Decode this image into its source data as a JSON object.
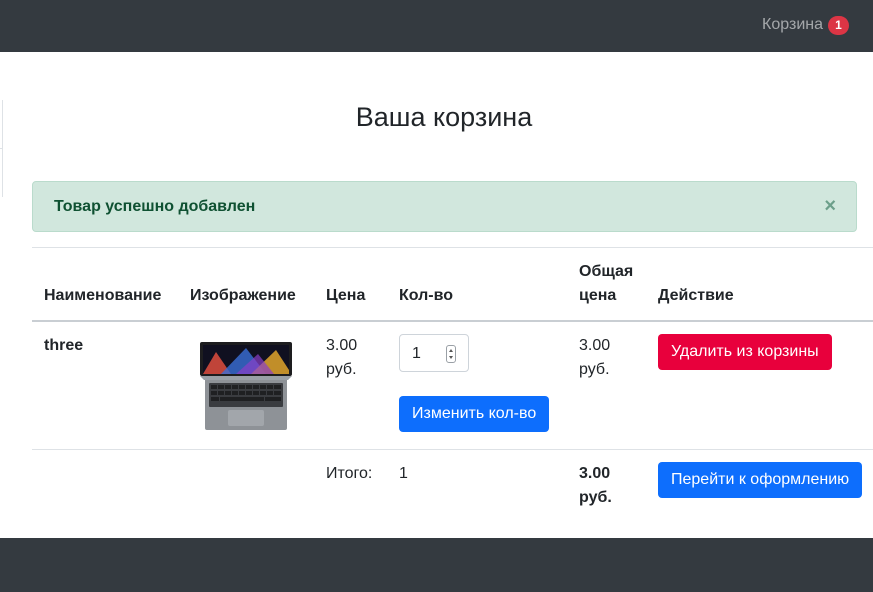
{
  "navbar": {
    "cart_label": "Корзина",
    "cart_count": "1"
  },
  "page": {
    "title": "Ваша корзина"
  },
  "alert": {
    "message": "Товар успешно добавлен",
    "close_symbol": "×"
  },
  "table": {
    "headers": {
      "name": "Наименование",
      "image": "Изображение",
      "price": "Цена",
      "qty": "Кол-во",
      "total_line1": "Общая",
      "total_line2": "цена",
      "action": "Действие"
    },
    "rows": [
      {
        "name": "three",
        "image_icon": "laptop-image",
        "price_line1": "3.00",
        "price_line2": "руб.",
        "quantity": "1",
        "update_button": "Изменить кол-во",
        "total_line1": "3.00",
        "total_line2": "руб.",
        "remove_button": "Удалить из корзины"
      }
    ],
    "summary": {
      "label": "Итого:",
      "quantity": "1",
      "total_line1": "3.00",
      "total_line2": "руб.",
      "checkout_button": "Перейти к оформлению"
    }
  },
  "colors": {
    "navbar_bg": "#343a40",
    "primary": "#0d6efd",
    "danger": "#e8003c",
    "alert_bg": "#d1e7dd",
    "alert_text": "#0f5132"
  }
}
